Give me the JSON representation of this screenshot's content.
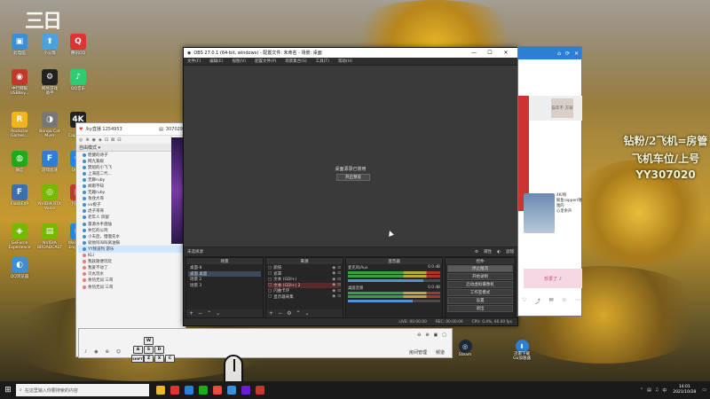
{
  "desktop_icons": [
    {
      "label": "此电脑",
      "color": "#3a8fd6",
      "glyph": "▣"
    },
    {
      "label": "小火箭",
      "color": "#4aa3df",
      "glyph": "⬆"
    },
    {
      "label": "腾讯QQ",
      "color": "#d33",
      "glyph": "Q"
    },
    {
      "label": "中行网银\nUSBKey...",
      "color": "#c0392b",
      "glyph": "◉"
    },
    {
      "label": "网易游戏\n助手",
      "color": "#222",
      "glyph": "⚙"
    },
    {
      "label": "QQ音乐",
      "color": "#2ecc71",
      "glyph": "♪"
    },
    {
      "label": "Rockstar\nGames...",
      "color": "#f1b51c",
      "glyph": "R"
    },
    {
      "label": "Bongo Cat\nMver",
      "color": "#777",
      "glyph": "◑"
    },
    {
      "label": "4K\nCapture...",
      "color": "#222",
      "glyph": "4K"
    },
    {
      "label": "微信",
      "color": "#1aad19",
      "glyph": "◍"
    },
    {
      "label": "游戏加速",
      "color": "#2b7fd6",
      "glyph": "F"
    },
    {
      "label": "QQaks",
      "color": "#1e88e5",
      "glyph": "Q"
    },
    {
      "label": "FlashFXP",
      "color": "#3a6fb5",
      "glyph": "F"
    },
    {
      "label": "NVIDIA RTX\nVoice",
      "color": "#76b900",
      "glyph": "◎"
    },
    {
      "label": "小黄虎盒",
      "color": "#c0392b",
      "glyph": "▦"
    },
    {
      "label": "GeForce\nExperience",
      "color": "#76b900",
      "glyph": "◈"
    },
    {
      "label": "NVIDIA\nBROADCAST",
      "color": "#76b900",
      "glyph": "▤"
    },
    {
      "label": "Wallpaper\nEngine:...",
      "color": "#1e88e5",
      "glyph": "▢"
    },
    {
      "label": "QQ浏览器",
      "color": "#3a8fd6",
      "glyph": "◐"
    }
  ],
  "promo": {
    "line1": "钻粉/2飞机=房管",
    "line2": "飞机车位/上号",
    "line3": "YY307020"
  },
  "live_app": {
    "title": "/ky直播 1254953",
    "count": "307029",
    "tools": [
      "◎",
      "⊕",
      "◉",
      "◈",
      "⊡",
      "⊠",
      "⊟"
    ],
    "head": "自由模式 ▾",
    "rows": [
      {
        "label": "稳健的诗子",
        "sel": false
      },
      {
        "label": "网九紫殿",
        "sel": false
      },
      {
        "label": "樊绍的小飞飞",
        "sel": false
      },
      {
        "label": "上海莲二代...",
        "sel": false
      },
      {
        "label": "无聊ruby",
        "sel": false
      },
      {
        "label": "闻雨不知",
        "sel": false
      },
      {
        "label": "无趣ruby",
        "sel": false
      },
      {
        "label": "孜孜大哥",
        "sel": false
      },
      {
        "label": "vv橙子",
        "sel": false
      },
      {
        "label": "虎子哥哥",
        "sel": false
      },
      {
        "label": "老年人 风留",
        "sel": false
      },
      {
        "label": "雷源水手盘陆",
        "sel": false
      },
      {
        "label": "失忆的公鸡",
        "sel": false
      },
      {
        "label": "小天后，慢慢先水",
        "sel": false
      },
      {
        "label": "就他吗叫叫窝油锅",
        "sel": false
      },
      {
        "label": "YY频道列 游乐",
        "sel": true
      },
      {
        "label": "KLI",
        "sel": false
      },
      {
        "label": "我就随便玩玩",
        "sel": false
      },
      {
        "label": "我爱不动了",
        "sel": false
      },
      {
        "label": "贝丸玩水",
        "sel": false
      },
      {
        "label": "余热无词 三哥",
        "sel": false
      },
      {
        "label": "余热无词 三哥",
        "sel": false
      }
    ]
  },
  "obs": {
    "title": "OBS 27.0.1 (64-bit, windows) - 配置文件: 未命名 - 场景: 桌面",
    "menu": [
      "文件(F)",
      "编辑(E)",
      "视图(V)",
      "配置文件(P)",
      "场景集合(S)",
      "工具(T)",
      "帮助(H)"
    ],
    "preview_msg": "桌面源录已禁用",
    "preview_btn": "开启预览",
    "src_bar_left": "未选择源",
    "src_bar_props": "属性",
    "src_bar_filters": "滤镜",
    "docks": {
      "scenes_title": "场景",
      "sources_title": "来源",
      "mixer_title": "混音器",
      "controls_title": "控件"
    },
    "scenes": [
      {
        "label": "桌面-8",
        "sel": false
      },
      {
        "label": "桌面 桌面",
        "sel": true
      },
      {
        "label": "场景 2",
        "sel": false
      },
      {
        "label": "场景 3",
        "sel": false
      }
    ],
    "sources": [
      {
        "label": "颜值",
        "sel": false
      },
      {
        "label": "遮罩",
        "sel": false
      },
      {
        "label": "文本 (GDI+)",
        "sel": false
      },
      {
        "label": "文本 (GDI+) 2",
        "sel": true
      },
      {
        "label": "闪曲卡环",
        "sel": false
      },
      {
        "label": "显示器采集",
        "sel": false
      }
    ],
    "mixer": [
      {
        "label": "麦克风/Aux",
        "db": "0.0 dB",
        "vol": 0.82
      },
      {
        "label": "桌面音频",
        "db": "0.0 dB",
        "vol": 0.7
      }
    ],
    "controls": [
      "停止推流",
      "开始录制",
      "启动虚拟摄像机",
      "工作室模式",
      "设置",
      "退出"
    ],
    "status": [
      "LIVE: 00:00:00",
      "REC: 00:00:00",
      "CPU: 0.4%, 60.00 fps"
    ]
  },
  "web_win": {
    "banner": "猫年不\n方骑",
    "photo_side": "4K/粉\n鲸鱼rapper/噶嗤的\n心里余声",
    "pink": "珍爱了 ♪"
  },
  "bottom_panel": {
    "quick": [
      "⊖",
      "⊕",
      "▣",
      "▢"
    ],
    "tools": [
      "♪",
      "◉",
      "⊕",
      "☺"
    ],
    "tag1": "房间管理",
    "tag2": "频道"
  },
  "keyboard": [
    "W",
    "A",
    "S",
    "D",
    "SHIFT",
    "Z",
    "X",
    "C"
  ],
  "steam_label": "Steam",
  "dl_label": "迅雷下载\nGo加速器",
  "taskbar": {
    "search_placeholder": "在这里输入你要搜索的内容",
    "apps": [
      "#e8b72a",
      "#d33",
      "#2b7fd6",
      "#1aad19",
      "#e74c3c",
      "#3a8fd6",
      "#6b1dd6",
      "#c0392b"
    ],
    "time": "14:01",
    "date": "2021/10/28"
  }
}
